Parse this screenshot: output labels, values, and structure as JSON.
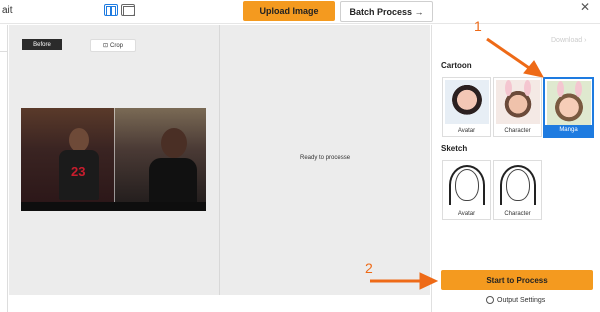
{
  "header": {
    "app_title": "ait",
    "upload_label": "Upload Image",
    "batch_label": "Batch Process →"
  },
  "canvas": {
    "before_label": "Before",
    "crop_label": "Crop",
    "ready_text": "Ready to processe"
  },
  "panel": {
    "download_label": "Download",
    "cartoon_title": "Cartoon",
    "cartoon_styles": [
      {
        "label": "Avatar",
        "selected": false
      },
      {
        "label": "Character",
        "selected": false
      },
      {
        "label": "Manga",
        "selected": true
      }
    ],
    "sketch_title": "Sketch",
    "sketch_styles": [
      {
        "label": "Avatar"
      },
      {
        "label": "Character"
      }
    ],
    "start_label": "Start to Process",
    "output_settings_label": "Output Settings"
  },
  "annotations": {
    "step1": "1",
    "step2": "2"
  },
  "colors": {
    "accent_orange": "#f49a1f",
    "selected_blue": "#1e7be0",
    "annotation_orange": "#ee6a17"
  }
}
